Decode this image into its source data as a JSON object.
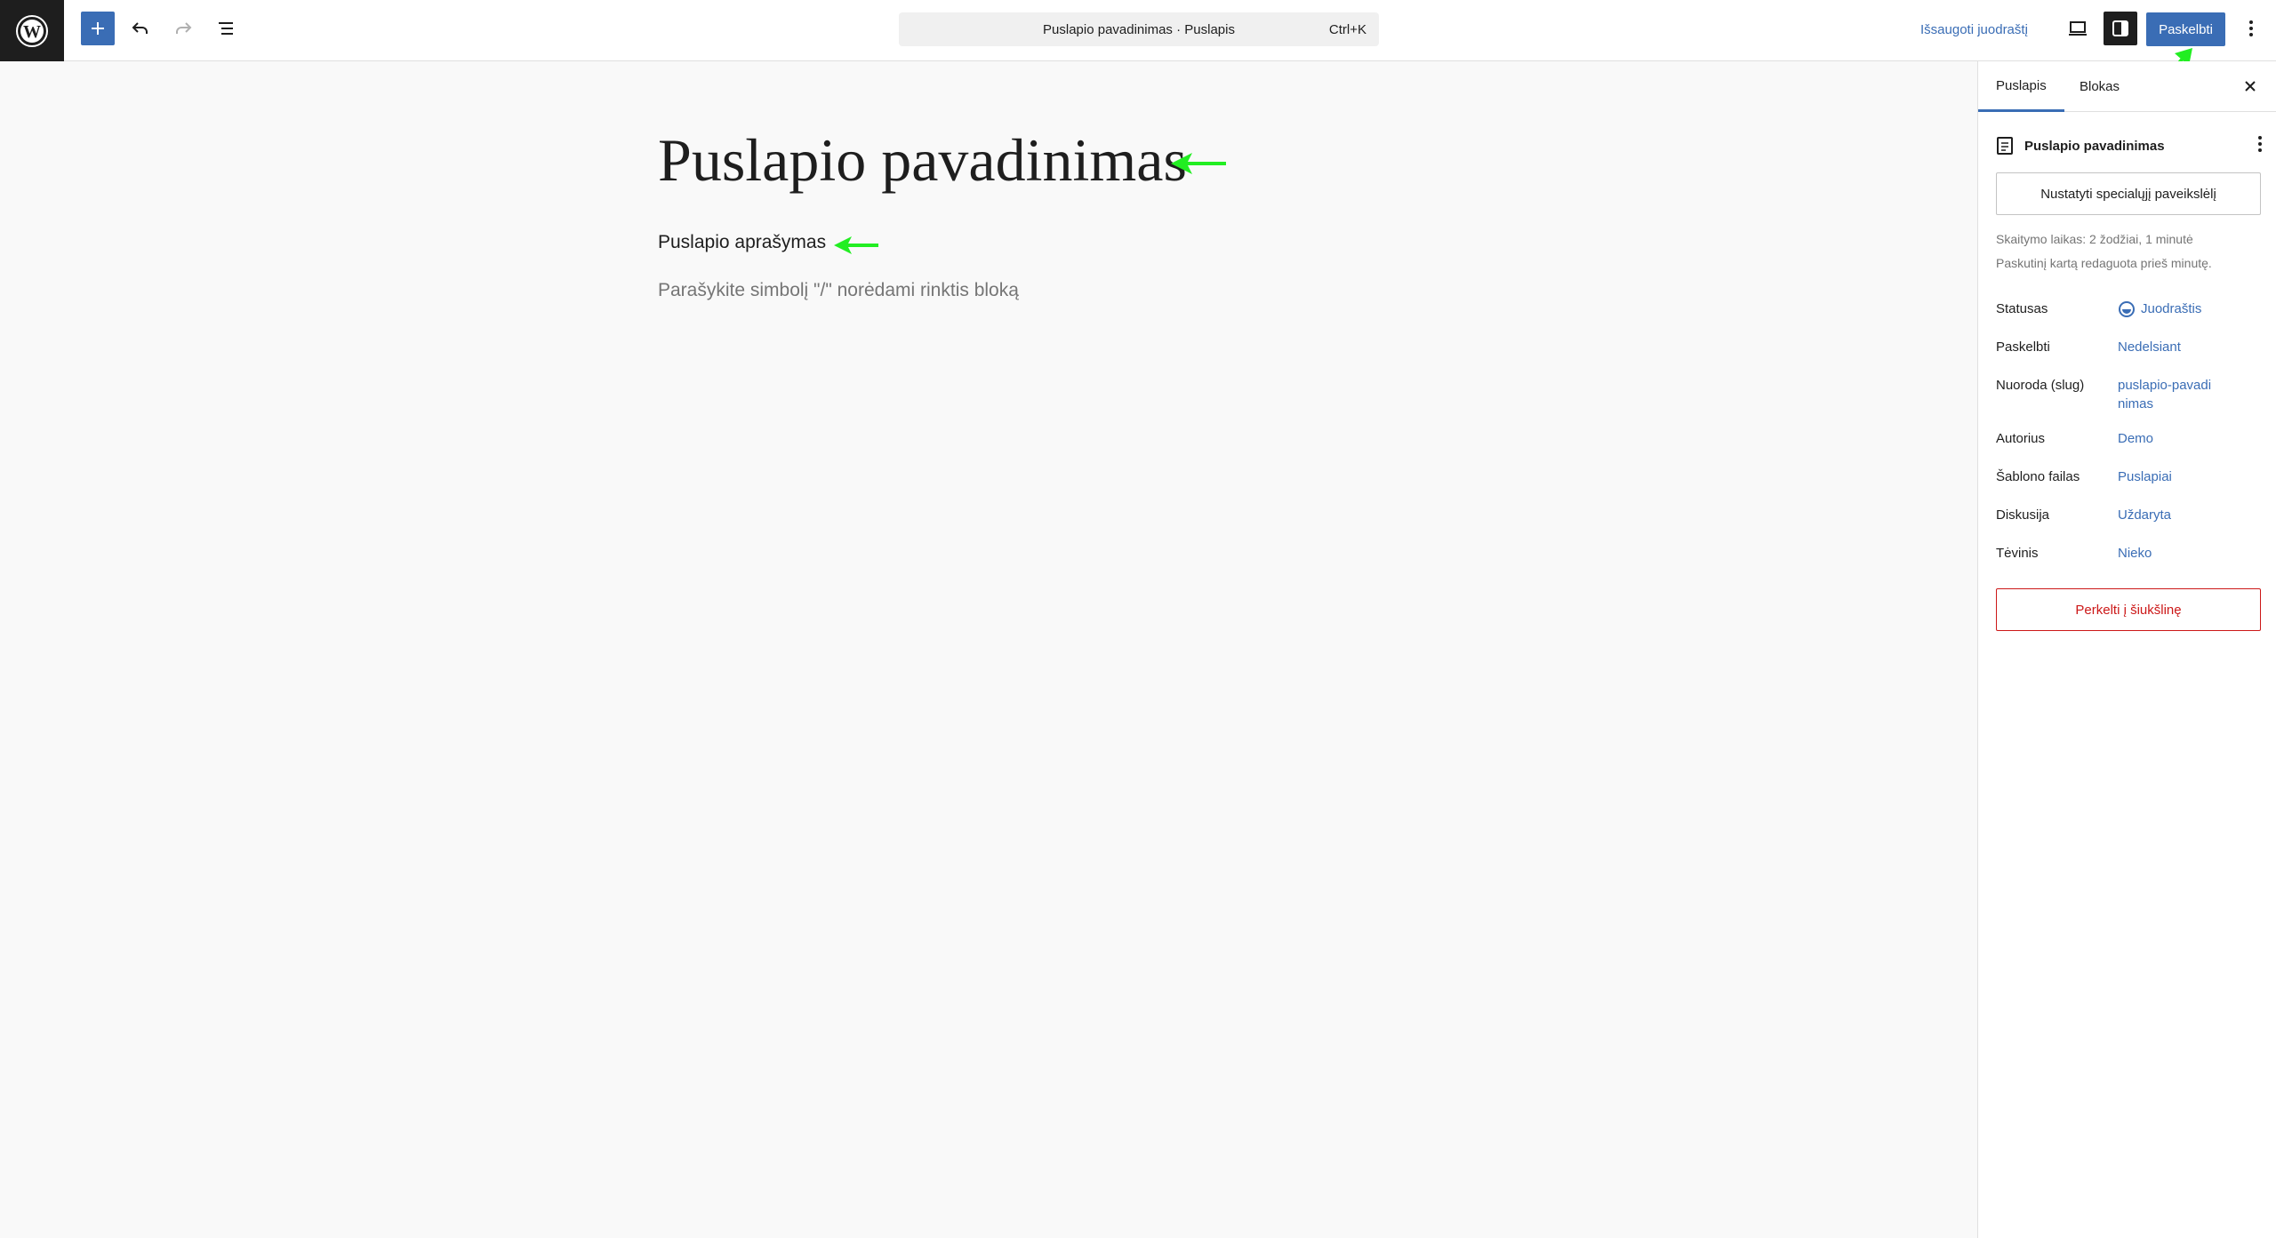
{
  "toolbar": {
    "command_title": "Puslapio pavadinimas · Puslapis",
    "command_shortcut": "Ctrl+K",
    "save_draft": "Išsaugoti juodraštį",
    "publish": "Paskelbti"
  },
  "editor": {
    "title": "Puslapio pavadinimas",
    "description": "Puslapio aprašymas",
    "placeholder": "Parašykite simbolį \"/\" norėdami rinktis bloką"
  },
  "sidebar": {
    "tabs": [
      {
        "label": "Puslapis",
        "active": true
      },
      {
        "label": "Blokas",
        "active": false
      }
    ],
    "doc_title": "Puslapio pavadinimas",
    "featured_image_button": "Nustatyti specialųjį paveikslėlį",
    "reading_time": "Skaitymo laikas: 2 žodžiai, 1 minutė",
    "last_edited": "Paskutinį kartą redaguota prieš minutę.",
    "rows": [
      {
        "label": "Statusas",
        "value": "Juodraštis"
      },
      {
        "label": "Paskelbti",
        "value": "Nedelsiant"
      },
      {
        "label": "Nuoroda (slug)",
        "value": "puslapio-pavadinimas"
      },
      {
        "label": "Autorius",
        "value": "Demo"
      },
      {
        "label": "Šablono failas",
        "value": "Puslapiai"
      },
      {
        "label": "Diskusija",
        "value": "Uždaryta"
      },
      {
        "label": "Tėvinis",
        "value": "Nieko"
      }
    ],
    "trash_button": "Perkelti į šiukšlinę"
  },
  "colors": {
    "accent": "#3a6db5",
    "annotation_arrow": "#22ee22",
    "danger": "#cc1818"
  }
}
